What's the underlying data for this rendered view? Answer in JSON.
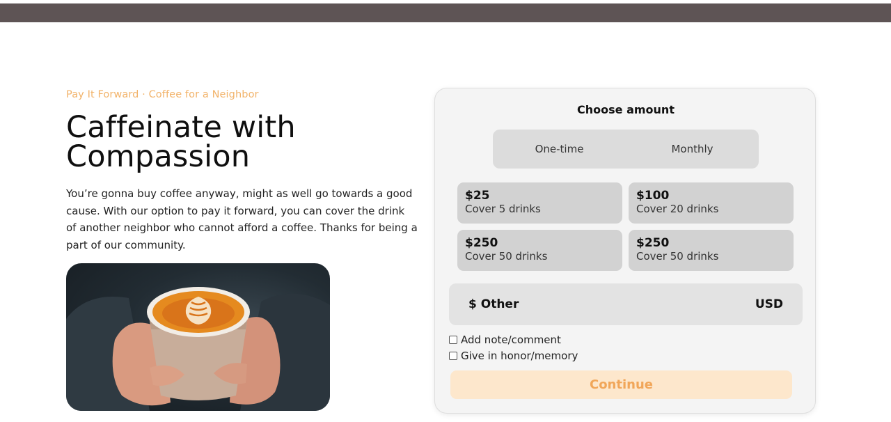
{
  "hero": {
    "eyebrow": "Pay It Forward · Coffee for a Neighbor",
    "headline_line1": "Caffeinate with",
    "headline_line2": "Compassion",
    "body": "You’re gonna buy coffee anyway, might as well go towards a good cause. With our option to pay it forward, you can cover the drink of another neighbor who cannot afford a coffee. Thanks for being a part of our community."
  },
  "donation": {
    "title": "Choose amount",
    "frequency": [
      "One-time",
      "Monthly"
    ],
    "amounts": [
      {
        "value": "$25",
        "desc": "Cover 5 drinks"
      },
      {
        "value": "$100",
        "desc": "Cover 20 drinks"
      },
      {
        "value": "$250",
        "desc": "Cover 50 drinks"
      },
      {
        "value": "$250",
        "desc": "Cover 50 drinks"
      }
    ],
    "other_label": "$ Other",
    "currency": "USD",
    "options": [
      "Add note/comment",
      "Give in honor/memory"
    ],
    "continue_label": "Continue"
  },
  "colors": {
    "topbar": "#5e5455",
    "accent": "#f2b36a",
    "continue_bg": "#fde7cc"
  }
}
